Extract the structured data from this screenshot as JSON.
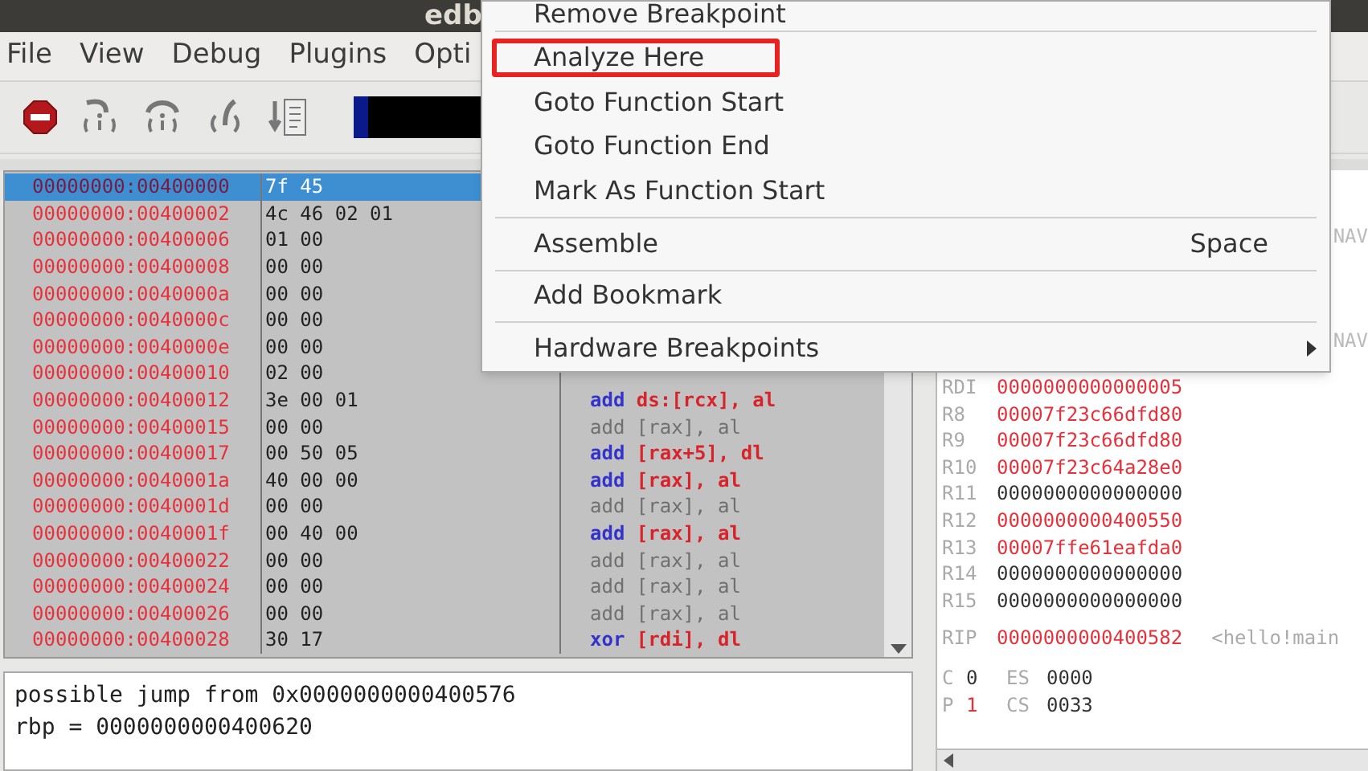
{
  "window": {
    "title": "edb"
  },
  "menu_bar": [
    {
      "label": "File"
    },
    {
      "label": "View"
    },
    {
      "label": "Debug"
    },
    {
      "label": "Plugins"
    },
    {
      "label": "Opti"
    }
  ],
  "disassembly": [
    {
      "address": "00000000:00400000",
      "bytes": "7f 45",
      "selected": true
    },
    {
      "address": "00000000:00400002",
      "bytes": "4c 46 02 01",
      "selected": false
    },
    {
      "address": "00000000:00400006",
      "bytes": "01 00",
      "selected": false
    },
    {
      "address": "00000000:00400008",
      "bytes": "00 00",
      "selected": false
    },
    {
      "address": "00000000:0040000a",
      "bytes": "00 00",
      "selected": false
    },
    {
      "address": "00000000:0040000c",
      "bytes": "00 00",
      "selected": false
    },
    {
      "address": "00000000:0040000e",
      "bytes": "00 00",
      "selected": false
    },
    {
      "address": "00000000:00400010",
      "bytes": "02 00",
      "selected": false
    },
    {
      "address": "00000000:00400012",
      "bytes": "3e 00 01",
      "selected": false,
      "mnemonic": "add",
      "operands": "ds:[rcx], al",
      "dim": false
    },
    {
      "address": "00000000:00400015",
      "bytes": "00 00",
      "selected": false,
      "mnemonic": "add",
      "operands": "[rax], al",
      "dim": true
    },
    {
      "address": "00000000:00400017",
      "bytes": "00 50 05",
      "selected": false,
      "mnemonic": "add",
      "operands": "[rax+5], dl",
      "dim": false
    },
    {
      "address": "00000000:0040001a",
      "bytes": "40 00 00",
      "selected": false,
      "mnemonic": "add",
      "operands": "[rax], al",
      "dim": false
    },
    {
      "address": "00000000:0040001d",
      "bytes": "00 00",
      "selected": false,
      "mnemonic": "add",
      "operands": "[rax], al",
      "dim": true
    },
    {
      "address": "00000000:0040001f",
      "bytes": "00 40 00",
      "selected": false,
      "mnemonic": "add",
      "operands": "[rax], al",
      "dim": false
    },
    {
      "address": "00000000:00400022",
      "bytes": "00 00",
      "selected": false,
      "mnemonic": "add",
      "operands": "[rax], al",
      "dim": true
    },
    {
      "address": "00000000:00400024",
      "bytes": "00 00",
      "selected": false,
      "mnemonic": "add",
      "operands": "[rax], al",
      "dim": true
    },
    {
      "address": "00000000:00400026",
      "bytes": "00 00",
      "selected": false,
      "mnemonic": "add",
      "operands": "[rax], al",
      "dim": true
    },
    {
      "address": "00000000:00400028",
      "bytes": "30 17",
      "selected": false,
      "mnemonic": "xor",
      "operands": "[rdi], dl",
      "dim": false
    }
  ],
  "log": [
    "possible jump from 0x0000000000400576",
    "rbp = 0000000000400620"
  ],
  "register_comments": [
    "NAV",
    "NAV"
  ],
  "registers": [
    {
      "name": "RDI",
      "value": "0000000000000005",
      "changed": true
    },
    {
      "name": "R8",
      "value": "00007f23c66dfd80",
      "changed": true
    },
    {
      "name": "R9",
      "value": "00007f23c66dfd80",
      "changed": true
    },
    {
      "name": "R10",
      "value": "00007f23c64a28e0",
      "changed": true
    },
    {
      "name": "R11",
      "value": "0000000000000000",
      "changed": false
    },
    {
      "name": "R12",
      "value": "0000000000400550",
      "changed": true
    },
    {
      "name": "R13",
      "value": "00007ffe61eafda0",
      "changed": true
    },
    {
      "name": "R14",
      "value": "0000000000000000",
      "changed": false
    },
    {
      "name": "R15",
      "value": "0000000000000000",
      "changed": false
    }
  ],
  "rip": {
    "name": "RIP",
    "value": "0000000000400582",
    "changed": true,
    "symbol": "<hello!main"
  },
  "flags": [
    {
      "flag": "C",
      "value": "0",
      "changed": false,
      "segment": "ES",
      "segment_value": "0000"
    },
    {
      "flag": "P",
      "value": "1",
      "changed": true,
      "segment": "CS",
      "segment_value": "0033"
    }
  ],
  "context_menu": [
    {
      "kind": "item",
      "label": "Remove Breakpoint",
      "highlighted": false
    },
    {
      "kind": "separator"
    },
    {
      "kind": "item",
      "label": "Analyze Here",
      "highlighted": true
    },
    {
      "kind": "item",
      "label": "Goto Function Start",
      "highlighted": false
    },
    {
      "kind": "item",
      "label": "Goto Function End",
      "highlighted": false
    },
    {
      "kind": "item",
      "label": "Mark As Function Start",
      "highlighted": false
    },
    {
      "kind": "separator"
    },
    {
      "kind": "item",
      "label": "Assemble",
      "shortcut": "Space",
      "highlighted": false
    },
    {
      "kind": "separator"
    },
    {
      "kind": "item",
      "label": "Add Bookmark",
      "highlighted": false
    },
    {
      "kind": "separator"
    },
    {
      "kind": "item",
      "label": "Hardware Breakpoints",
      "submenu": true,
      "highlighted": false
    }
  ]
}
